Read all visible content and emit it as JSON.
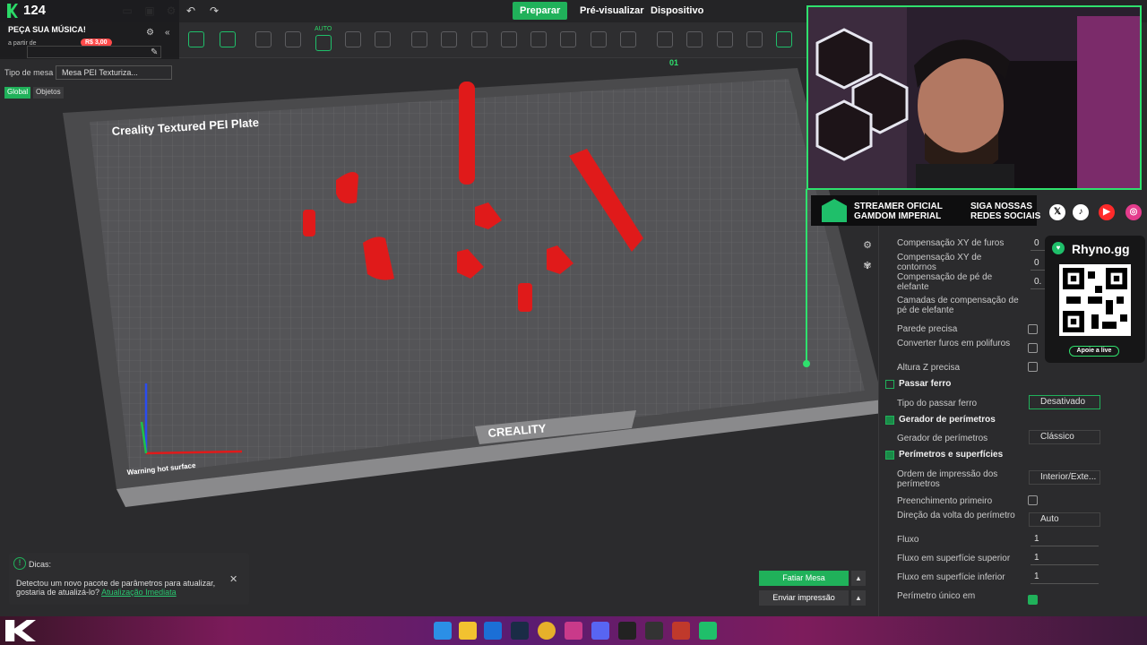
{
  "topbar": {
    "prepare_label": "Preparar",
    "preview_label": "Pré-visualizar",
    "device_label": "Dispositivo"
  },
  "live_overlay": {
    "count": "124",
    "request_song": "PEÇA SUA MÚSICA!",
    "from_label": "a partir de",
    "price": "R$ 3,00"
  },
  "left": {
    "bed_type_label": "Tipo de mesa",
    "bed_type_value": "Mesa PEI Texturiza...",
    "tab_global": "Global",
    "tab_objects": "Objetos",
    "toolbar_auto": "AUTO"
  },
  "bed": {
    "title": "Creality Textured PEI Plate",
    "brand": "CREALITY",
    "warning": "Warning hot surface",
    "plate_number": "01"
  },
  "settings": {
    "rows": [
      {
        "label": "Compensação XY de furos",
        "value": "0"
      },
      {
        "label": "Compensação XY de contornos",
        "value": "0"
      },
      {
        "label": "Compensação de pé de elefante",
        "value": "0."
      },
      {
        "label": "Camadas de compensação de pé de elefante",
        "value": ""
      },
      {
        "label": "Parede precisa",
        "checked": false
      },
      {
        "label": "Converter furos em polifuros",
        "checked": false
      },
      {
        "label": "Altura Z precisa",
        "checked": false
      }
    ],
    "ironing_section": "Passar ferro",
    "ironing_type_label": "Tipo do passar ferro",
    "ironing_type_value": "Desativado",
    "perimeter_gen_section": "Gerador de perímetros",
    "perimeter_gen_label": "Gerador de perímetros",
    "perimeter_gen_value": "Clássico",
    "perimeters_section": "Perímetros e superfícies",
    "order_label": "Ordem de impressão dos perímetros",
    "order_value": "Interior/Exte...",
    "infill_first_label": "Preenchimento primeiro",
    "direction_label": "Direção da volta do perímetro",
    "direction_value": "Auto",
    "flow_label": "Fluxo",
    "flow_value": "1",
    "top_flow_label": "Fluxo em superfície superior",
    "top_flow_value": "1",
    "bottom_flow_label": "Fluxo em superfície inferior",
    "bottom_flow_value": "1",
    "single_perimeter_label": "Perímetro único em"
  },
  "stream": {
    "streamer_line1": "STREAMER OFICIAL",
    "streamer_line2": "GAMDOM IMPERIAL",
    "follow_line1": "SIGA NOSSAS",
    "follow_line2": "REDES SOCIAIS",
    "site": "Rhyno.gg",
    "support": "Apoie a live"
  },
  "actions": {
    "slice_label": "Fatiar Mesa",
    "send_label": "Enviar impressão"
  },
  "tip": {
    "title": "Dicas:",
    "text": "Detectou um novo pacote de parâmetros para atualizar, gostaria de atualizá-lo?",
    "link": "Atualização Imediata"
  }
}
